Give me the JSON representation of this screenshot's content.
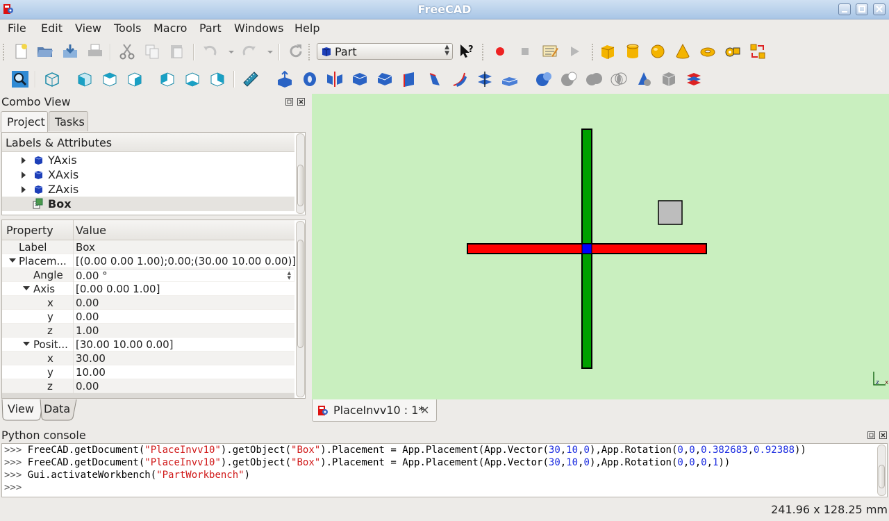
{
  "window": {
    "title": "FreeCAD"
  },
  "menubar": [
    "File",
    "Edit",
    "View",
    "Tools",
    "Macro",
    "Part",
    "Windows",
    "Help"
  ],
  "workbench": {
    "selected": "Part"
  },
  "combo_view": {
    "title": "Combo View",
    "tabs": [
      "Project",
      "Tasks"
    ],
    "tree_header": "Labels & Attributes",
    "tree_items": [
      {
        "label": "YAxis",
        "icon": "cube-icon"
      },
      {
        "label": "XAxis",
        "icon": "cube-icon"
      },
      {
        "label": "ZAxis",
        "icon": "cube-icon"
      },
      {
        "label": "Box",
        "icon": "box-feature-icon"
      }
    ],
    "property_header": {
      "name": "Property",
      "value": "Value"
    },
    "properties": [
      {
        "name": "Label",
        "value": "Box"
      },
      {
        "name": "Placem...",
        "value": "[(0.00 0.00 1.00);0.00;(30.00 10.00 0.00)]"
      },
      {
        "name": "Angle",
        "value": "0.00 °"
      },
      {
        "name": "Axis",
        "value": "[0.00 0.00 1.00]"
      },
      {
        "name": "x",
        "value": "0.00"
      },
      {
        "name": "y",
        "value": "0.00"
      },
      {
        "name": "z",
        "value": "1.00"
      },
      {
        "name": "Posit...",
        "value": "[30.00 10.00 0.00]"
      },
      {
        "name": "x",
        "value": "30.00"
      },
      {
        "name": "y",
        "value": "10.00"
      },
      {
        "name": "z",
        "value": "0.00"
      }
    ],
    "bottom_tabs": [
      "View",
      "Data"
    ]
  },
  "document_tab": {
    "label": "PlaceInvv10 : 1*"
  },
  "python_console": {
    "title": "Python console",
    "lines": [
      [
        {
          "t": ">>> ",
          "c": "p"
        },
        {
          "t": "FreeCAD.getDocument(",
          "c": ""
        },
        {
          "t": "\"PlaceInvv10\"",
          "c": "s"
        },
        {
          "t": ").getObject(",
          "c": ""
        },
        {
          "t": "\"Box\"",
          "c": "s"
        },
        {
          "t": ").Placement = App.Placement(App.Vector(",
          "c": ""
        },
        {
          "t": "30",
          "c": "n"
        },
        {
          "t": ",",
          "c": ""
        },
        {
          "t": "10",
          "c": "n"
        },
        {
          "t": ",",
          "c": ""
        },
        {
          "t": "0",
          "c": "n"
        },
        {
          "t": "),App.Rotation(",
          "c": ""
        },
        {
          "t": "0",
          "c": "n"
        },
        {
          "t": ",",
          "c": ""
        },
        {
          "t": "0",
          "c": "n"
        },
        {
          "t": ",",
          "c": ""
        },
        {
          "t": "0.382683",
          "c": "n"
        },
        {
          "t": ",",
          "c": ""
        },
        {
          "t": "0.92388",
          "c": "n"
        },
        {
          "t": "))",
          "c": ""
        }
      ],
      [
        {
          "t": ">>> ",
          "c": "p"
        },
        {
          "t": "FreeCAD.getDocument(",
          "c": ""
        },
        {
          "t": "\"PlaceInvv10\"",
          "c": "s"
        },
        {
          "t": ").getObject(",
          "c": ""
        },
        {
          "t": "\"Box\"",
          "c": "s"
        },
        {
          "t": ").Placement = App.Placement(App.Vector(",
          "c": ""
        },
        {
          "t": "30",
          "c": "n"
        },
        {
          "t": ",",
          "c": ""
        },
        {
          "t": "10",
          "c": "n"
        },
        {
          "t": ",",
          "c": ""
        },
        {
          "t": "0",
          "c": "n"
        },
        {
          "t": "),App.Rotation(",
          "c": ""
        },
        {
          "t": "0",
          "c": "n"
        },
        {
          "t": ",",
          "c": ""
        },
        {
          "t": "0",
          "c": "n"
        },
        {
          "t": ",",
          "c": ""
        },
        {
          "t": "0",
          "c": "n"
        },
        {
          "t": ",",
          "c": ""
        },
        {
          "t": "1",
          "c": "n"
        },
        {
          "t": "))",
          "c": ""
        }
      ],
      [
        {
          "t": ">>> ",
          "c": "p"
        },
        {
          "t": "Gui.activateWorkbench(",
          "c": ""
        },
        {
          "t": "\"PartWorkbench\"",
          "c": "s"
        },
        {
          "t": ")",
          "c": ""
        }
      ],
      [
        {
          "t": ">>> ",
          "c": "p"
        }
      ]
    ]
  },
  "status": {
    "dimensions": "241.96 x 128.25 mm"
  },
  "colors": {
    "viewer_background": "#c9efbf",
    "x_axis": "#ff0000",
    "y_axis": "#00a000",
    "z_axis": "#0000ff",
    "box": "#bdbdbd"
  }
}
